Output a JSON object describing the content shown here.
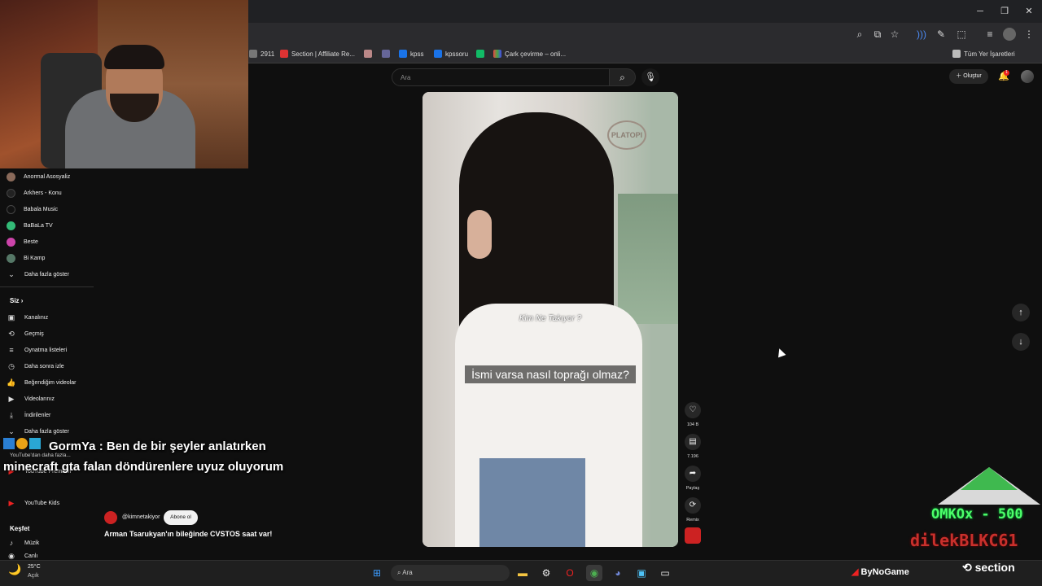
{
  "browser": {
    "bookmarks": [
      {
        "label": "2911",
        "color": "#888"
      },
      {
        "label": "Section | Affiliate Re...",
        "color": "#d33"
      },
      {
        "label": "",
        "color": "#b88"
      },
      {
        "label": "",
        "color": "#669"
      },
      {
        "label": "kpss",
        "color": "#1a73e8"
      },
      {
        "label": "kpssoru",
        "color": "#1a73e8"
      },
      {
        "label": "",
        "color": "#1b6"
      },
      {
        "label": "Çark çevirme – onli...",
        "color": "#e84"
      }
    ],
    "all_bookmarks_label": "Tüm Yer İşaretleri"
  },
  "youtube": {
    "search_placeholder": "Ara",
    "create_label": "Oluştur",
    "notification_count": "1",
    "subscriptions": [
      {
        "label": "Anormal Asosyaliz",
        "color": "#8a6a5a"
      },
      {
        "label": "Arkhers - Konu",
        "color": "#222"
      },
      {
        "label": "Babala Music",
        "color": "#111"
      },
      {
        "label": "BaBaLa TV",
        "color": "#3b7"
      },
      {
        "label": "Beste",
        "color": "#c4a"
      },
      {
        "label": "Bi Kamp",
        "color": "#576"
      },
      {
        "label": "Daha fazla göster",
        "color": ""
      }
    ],
    "you_section": "Siz",
    "you_items": [
      {
        "label": "Kanalınız",
        "icon": "▣"
      },
      {
        "label": "Geçmiş",
        "icon": "⟲"
      },
      {
        "label": "Oynatma listeleri",
        "icon": "≡"
      },
      {
        "label": "Daha sonra izle",
        "icon": "◷"
      },
      {
        "label": "Beğendiğim videolar",
        "icon": "👍"
      },
      {
        "label": "Videolarınız",
        "icon": "▶"
      },
      {
        "label": "İndirilenler",
        "icon": "⤓"
      },
      {
        "label": "Daha fazla göster",
        "icon": "⌄"
      }
    ],
    "more_from_youtube": "YouTube'dan daha fazla...",
    "yt_premium": "YouTube Premium",
    "yt_kids": "YouTube Kids",
    "explore_section": "Keşfet",
    "explore_items": [
      {
        "label": "Müzik",
        "icon": "♪"
      },
      {
        "label": "Canlı",
        "icon": "((·))"
      }
    ],
    "short": {
      "overlay_small": "Kim Ne Takıyor ?",
      "subtitle": "İsmi varsa nasıl toprağı olmaz?",
      "channel": "@kimnetakiyor",
      "subscribe_label": "Abone ol",
      "title": "Arman Tsarukyan'ın bileğinde CVSTOS saat var!",
      "likes": "104 B",
      "comments": "7.196",
      "share_label": "Paylaş",
      "remix_label": "Remix"
    }
  },
  "chat": {
    "user": "GormYa",
    "message": "GormYa : Ben de bir şeyler anlatırken minecraft gta falan döndürenlere uyuz oluyorum"
  },
  "overlay": {
    "goal_text": "OMKOx - 500",
    "donor_text": "dilekBLKC61",
    "sponsor1": "ByNoGame",
    "sponsor2": "section"
  },
  "taskbar": {
    "weather_temp": "25°C",
    "weather_desc": "Açık",
    "search_placeholder": "Ara"
  }
}
